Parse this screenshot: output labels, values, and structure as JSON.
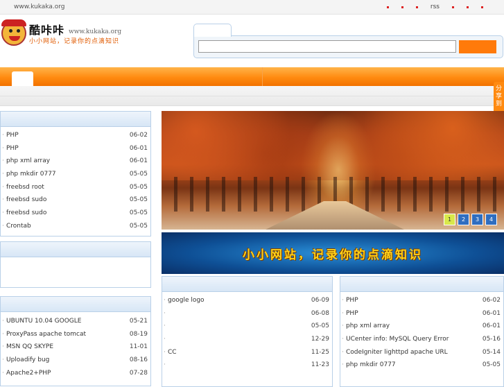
{
  "topbar": {
    "site": "www.kukaka.org",
    "rss": "rss"
  },
  "logo": {
    "brand": "酷咔咔",
    "url": "www.kukaka.org",
    "slogan": "小小网站，记录你的点滴知识"
  },
  "share": "分享到",
  "left_list": [
    {
      "title": "PHP",
      "date": "06-02"
    },
    {
      "title": "PHP",
      "date": "06-01"
    },
    {
      "title": "php   xml     array",
      "date": "06-01"
    },
    {
      "title": "php mkdir 0777",
      "date": "05-05"
    },
    {
      "title": "freebsd  root",
      "date": "05-05"
    },
    {
      "title": "freebsd sudo",
      "date": "05-05"
    },
    {
      "title": "freebsd sudo",
      "date": "05-05"
    },
    {
      "title": "Crontab",
      "date": "05-05"
    }
  ],
  "left_list3": [
    {
      "title": "UBUNTU 10.04  GOOGLE",
      "date": "05-21"
    },
    {
      "title": "ProxyPass  apache tomcat",
      "date": "08-19"
    },
    {
      "title": "MSN   QQ SKYPE",
      "date": "11-01"
    },
    {
      "title": "Uploadify bug",
      "date": "08-16"
    },
    {
      "title": "Apache2+PHP",
      "date": "07-28"
    }
  ],
  "banner": {
    "pages": [
      "1",
      "2",
      "3",
      "4"
    ]
  },
  "slogan_banner": "小小网站，记录你的点滴知识",
  "mid_list": [
    {
      "title": "google logo",
      "date": "06-09"
    },
    {
      "title": "",
      "date": "06-08"
    },
    {
      "title": "",
      "date": "05-05"
    },
    {
      "title": "",
      "date": "12-29"
    },
    {
      "title": "CC",
      "date": "11-25"
    },
    {
      "title": "",
      "date": "11-23"
    }
  ],
  "right_list": [
    {
      "title": "PHP",
      "date": "06-02"
    },
    {
      "title": "PHP",
      "date": "06-01"
    },
    {
      "title": "php   xml     array",
      "date": "06-01"
    },
    {
      "title": "UCenter info: MySQL Query Error",
      "date": "05-16"
    },
    {
      "title": "CodeIgniter   lighttpd apache URL",
      "date": "05-14"
    },
    {
      "title": "php mkdir 0777",
      "date": "05-05"
    }
  ]
}
